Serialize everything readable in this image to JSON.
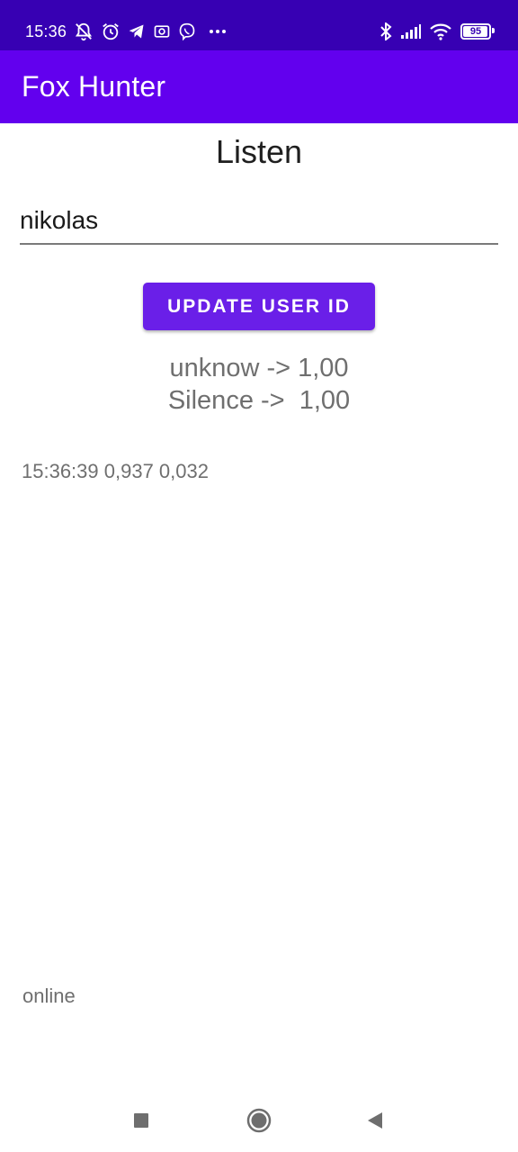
{
  "status_bar": {
    "time": "15:36",
    "left_icons": [
      "notifications-off-icon",
      "alarm-icon",
      "telegram-icon",
      "camera-app-icon",
      "viber-icon",
      "more-dots-icon"
    ],
    "right_icons": [
      "bluetooth-icon",
      "signal-icon",
      "wifi-icon"
    ],
    "battery_percent": "95",
    "battery_level": 0.95,
    "background_color": "#3700b3"
  },
  "app_bar": {
    "title": "Fox Hunter",
    "background_color": "#6200ee"
  },
  "main": {
    "heading": "Listen",
    "user_id_value": "nikolas",
    "update_button_label": "Update user ID",
    "button_color": "#6a1fe8",
    "results": [
      "unknow -> 1,00",
      "Silence ->  1,00"
    ],
    "log_line": "15:36:39 0,937 0,032",
    "connection_status": "online"
  },
  "nav_bar": {
    "buttons": [
      "recents-icon",
      "home-icon",
      "back-icon"
    ]
  }
}
